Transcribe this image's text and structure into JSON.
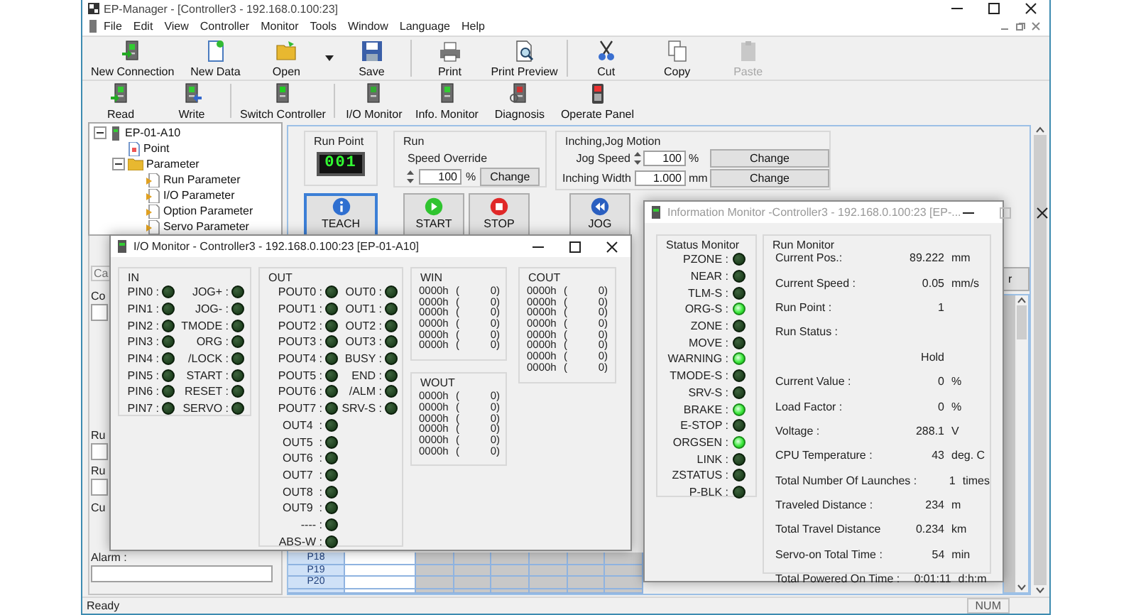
{
  "window": {
    "title": "EP-Manager - [Controller3 - 192.168.0.100:23]"
  },
  "menu": [
    "File",
    "Edit",
    "View",
    "Controller",
    "Monitor",
    "Tools",
    "Window",
    "Language",
    "Help"
  ],
  "toolbars": [
    {
      "groups": [
        {
          "buttons": [
            {
              "label": "New Connection",
              "dropdown": false,
              "disabled": false
            },
            {
              "label": "New Data",
              "dropdown": false,
              "disabled": false
            },
            {
              "label": "Open",
              "dropdown": true,
              "disabled": false
            },
            {
              "label": "Save",
              "dropdown": false,
              "disabled": false
            }
          ]
        },
        {
          "buttons": [
            {
              "label": "Print",
              "dropdown": false,
              "disabled": false
            },
            {
              "label": "Print Preview",
              "dropdown": false,
              "disabled": false
            }
          ]
        },
        {
          "buttons": [
            {
              "label": "Cut",
              "dropdown": false,
              "disabled": false
            },
            {
              "label": "Copy",
              "dropdown": false,
              "disabled": false
            },
            {
              "label": "Paste",
              "dropdown": false,
              "disabled": true
            }
          ]
        }
      ]
    },
    {
      "groups": [
        {
          "buttons": [
            {
              "label": "Read",
              "dropdown": false,
              "disabled": false
            },
            {
              "label": "Write",
              "dropdown": false,
              "disabled": false
            }
          ]
        },
        {
          "buttons": [
            {
              "label": "Switch Controller",
              "dropdown": false,
              "disabled": false
            }
          ]
        },
        {
          "buttons": [
            {
              "label": "I/O Monitor",
              "dropdown": false,
              "disabled": false
            },
            {
              "label": "Info. Monitor",
              "dropdown": false,
              "disabled": false
            },
            {
              "label": "Diagnosis",
              "dropdown": false,
              "disabled": false
            },
            {
              "label": "Operate Panel",
              "dropdown": false,
              "disabled": false
            }
          ]
        }
      ]
    }
  ],
  "tree": [
    {
      "label": "EP-01-A10",
      "expanded": true,
      "children": [
        {
          "label": "Point"
        },
        {
          "label": "Parameter",
          "expanded": true,
          "children": [
            {
              "label": "Run Parameter"
            },
            {
              "label": "I/O Parameter"
            },
            {
              "label": "Option Parameter"
            },
            {
              "label": "Servo Parameter"
            }
          ]
        }
      ]
    }
  ],
  "side_panel": {
    "tab": "Ca",
    "fields": [
      {
        "label": "Co",
        "kind": "input"
      },
      {
        "label": "Ru",
        "kind": "input"
      },
      {
        "label": "Ru",
        "kind": "input"
      },
      {
        "label": "Cu",
        "kind": "label"
      },
      {
        "label": "Alarm :",
        "kind": "input"
      }
    ]
  },
  "run_panel": {
    "run_point": {
      "title": "Run Point",
      "display": "001"
    },
    "run": {
      "title": "Run",
      "speed_label": "Speed Override",
      "speed": "100",
      "unit": "%",
      "button": "Change"
    },
    "jog": {
      "title": "Inching,Jog Motion",
      "rows": [
        {
          "label": "Jog Speed",
          "value": "100",
          "unit": "%",
          "spin": true,
          "button": "Change"
        },
        {
          "label": "Inching Width",
          "value": "1.000",
          "unit": "mm",
          "spin": false,
          "button": "Change"
        }
      ]
    },
    "buttons": [
      {
        "label": "TEACH",
        "kind": "info",
        "focused": true
      },
      {
        "label": "START",
        "kind": "start",
        "focused": false
      },
      {
        "label": "STOP",
        "kind": "stop",
        "focused": false
      },
      {
        "label": "JOG",
        "kind": "rewind",
        "focused": false
      }
    ]
  },
  "table": {
    "rows": [
      "P18",
      "P19",
      "P20"
    ]
  },
  "side_button": {
    "label": "r"
  },
  "io_monitor": {
    "title": "I/O Monitor - Controller3 - 192.168.0.100:23  [EP-01-A10]",
    "active": true,
    "in": {
      "title": "IN",
      "columns": [
        [
          {
            "label": "PIN0 :",
            "on": false
          },
          {
            "label": "PIN1 :",
            "on": false
          },
          {
            "label": "PIN2 :",
            "on": false
          },
          {
            "label": "PIN3 :",
            "on": false
          },
          {
            "label": "PIN4 :",
            "on": false
          },
          {
            "label": "PIN5 :",
            "on": false
          },
          {
            "label": "PIN6 :",
            "on": false
          },
          {
            "label": "PIN7 :",
            "on": false
          }
        ],
        [
          {
            "label": "JOG+ :",
            "on": false
          },
          {
            "label": "JOG- :",
            "on": false
          },
          {
            "label": "TMODE :",
            "on": false
          },
          {
            "label": "ORG :",
            "on": false
          },
          {
            "label": "/LOCK :",
            "on": false
          },
          {
            "label": "START :",
            "on": false
          },
          {
            "label": "RESET :",
            "on": false
          },
          {
            "label": "SERVO :",
            "on": false
          }
        ]
      ]
    },
    "out": {
      "title": "OUT",
      "columns": [
        [
          {
            "label": "POUT0 :",
            "on": false
          },
          {
            "label": "POUT1 :",
            "on": false
          },
          {
            "label": "POUT2 :",
            "on": false
          },
          {
            "label": "POUT3 :",
            "on": false
          },
          {
            "label": "POUT4 :",
            "on": false
          },
          {
            "label": "POUT5 :",
            "on": false
          },
          {
            "label": "POUT6 :",
            "on": false
          },
          {
            "label": "POUT7 :",
            "on": false
          },
          {
            "label": "OUT4  :",
            "on": false
          },
          {
            "label": "OUT5  :",
            "on": false
          },
          {
            "label": "OUT6  :",
            "on": false
          },
          {
            "label": "OUT7  :",
            "on": false
          },
          {
            "label": "OUT8  :",
            "on": false
          },
          {
            "label": "OUT9  :",
            "on": false
          },
          {
            "label": "---- :",
            "on": false
          },
          {
            "label": "ABS-W :",
            "on": false
          }
        ],
        [
          {
            "label": "OUT0 :",
            "on": false
          },
          {
            "label": "OUT1 :",
            "on": false
          },
          {
            "label": "OUT2 :",
            "on": false
          },
          {
            "label": "OUT3 :",
            "on": false
          },
          {
            "label": "BUSY :",
            "on": false
          },
          {
            "label": "END :",
            "on": false
          },
          {
            "label": "/ALM :",
            "on": false
          },
          {
            "label": "SRV-S :",
            "on": false
          }
        ]
      ]
    },
    "win": {
      "title": "WIN",
      "rows": [
        {
          "hex": "0000h",
          "open": "(",
          "dec": "0)"
        },
        {
          "hex": "0000h",
          "open": "(",
          "dec": "0)"
        },
        {
          "hex": "0000h",
          "open": "(",
          "dec": "0)"
        },
        {
          "hex": "0000h",
          "open": "(",
          "dec": "0)"
        },
        {
          "hex": "0000h",
          "open": "(",
          "dec": "0)"
        },
        {
          "hex": "0000h",
          "open": "(",
          "dec": "0)"
        }
      ]
    },
    "wout": {
      "title": "WOUT",
      "rows": [
        {
          "hex": "0000h",
          "open": "(",
          "dec": "0)"
        },
        {
          "hex": "0000h",
          "open": "(",
          "dec": "0)"
        },
        {
          "hex": "0000h",
          "open": "(",
          "dec": "0)"
        },
        {
          "hex": "0000h",
          "open": "(",
          "dec": "0)"
        },
        {
          "hex": "0000h",
          "open": "(",
          "dec": "0)"
        },
        {
          "hex": "0000h",
          "open": "(",
          "dec": "0)"
        }
      ]
    },
    "cout": {
      "title": "COUT",
      "rows": [
        {
          "hex": "0000h",
          "open": "(",
          "dec": "0)"
        },
        {
          "hex": "0000h",
          "open": "(",
          "dec": "0)"
        },
        {
          "hex": "0000h",
          "open": "(",
          "dec": "0)"
        },
        {
          "hex": "0000h",
          "open": "(",
          "dec": "0)"
        },
        {
          "hex": "0000h",
          "open": "(",
          "dec": "0)"
        },
        {
          "hex": "0000h",
          "open": "(",
          "dec": "0)"
        },
        {
          "hex": "0000h",
          "open": "(",
          "dec": "0)"
        },
        {
          "hex": "0000h",
          "open": "(",
          "dec": "0)"
        }
      ]
    }
  },
  "info_monitor": {
    "title": "Information Monitor -Controller3 - 192.168.0.100:23  [EP-...",
    "active": false,
    "status": {
      "title": "Status Monitor",
      "items": [
        {
          "label": "PZONE :",
          "on": false
        },
        {
          "label": "NEAR :",
          "on": false
        },
        {
          "label": "TLM-S :",
          "on": false
        },
        {
          "label": "ORG-S :",
          "on": true
        },
        {
          "label": "ZONE :",
          "on": false
        },
        {
          "label": "MOVE :",
          "on": false
        },
        {
          "label": "WARNING :",
          "on": true
        },
        {
          "label": "TMODE-S :",
          "on": false
        },
        {
          "label": "SRV-S :",
          "on": false
        },
        {
          "label": "BRAKE :",
          "on": true
        },
        {
          "label": "E-STOP :",
          "on": false
        },
        {
          "label": "ORGSEN :",
          "on": true
        },
        {
          "label": "LINK :",
          "on": false
        },
        {
          "label": "ZSTATUS :",
          "on": false
        },
        {
          "label": "P-BLK :",
          "on": false
        }
      ]
    },
    "run": {
      "title": "Run Monitor",
      "rows": [
        {
          "label": "Current Pos.:",
          "value": "89.222",
          "unit": "mm"
        },
        {
          "label": "Current Speed :",
          "value": "0.05",
          "unit": "mm/s"
        },
        {
          "label": "Run Point :",
          "value": "1"
        },
        {
          "label": "Run Status :"
        },
        {
          "value": "Hold"
        },
        {
          "label": "Current Value :",
          "value": "0",
          "unit": "%"
        },
        {
          "label": "Load Factor :",
          "value": "0",
          "unit": "%"
        },
        {
          "label": "Voltage :",
          "value": "288.1",
          "unit": "V"
        },
        {
          "label": "CPU Temperature :",
          "value": "43",
          "unit": "deg. C"
        },
        {
          "label": "Total Number Of Launches :",
          "value": "1",
          "unit": "times"
        },
        {
          "label": "Traveled Distance :",
          "value": "234",
          "unit": "m"
        },
        {
          "label": "Total Travel Distance",
          "value": "0.234",
          "unit": "km"
        },
        {
          "label": "Servo-on Total Time :",
          "value": "54",
          "unit": "min"
        },
        {
          "label": "Total Powered On Time :",
          "value": "0:01:11",
          "unit": "d:h:m"
        }
      ]
    }
  },
  "status_bar": {
    "text": "Ready",
    "indicator": "NUM"
  }
}
